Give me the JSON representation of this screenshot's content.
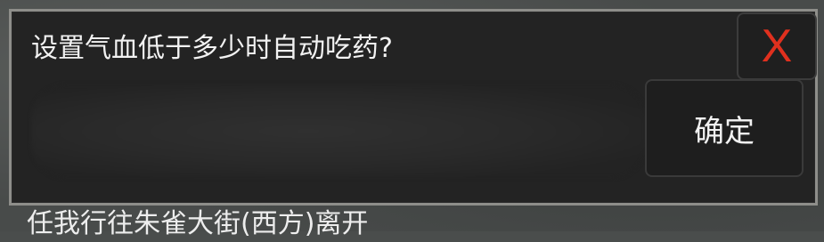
{
  "dialog": {
    "prompt": "设置气血低于多少时自动吃药?",
    "input_value": "",
    "close_label": "X",
    "confirm_label": "确定"
  },
  "background": {
    "route_text": "任我行往朱雀大街(西方)离开"
  },
  "colors": {
    "close_accent": "#e0301e",
    "dialog_bg": "#232323",
    "dialog_border": "#8e8e8a"
  }
}
